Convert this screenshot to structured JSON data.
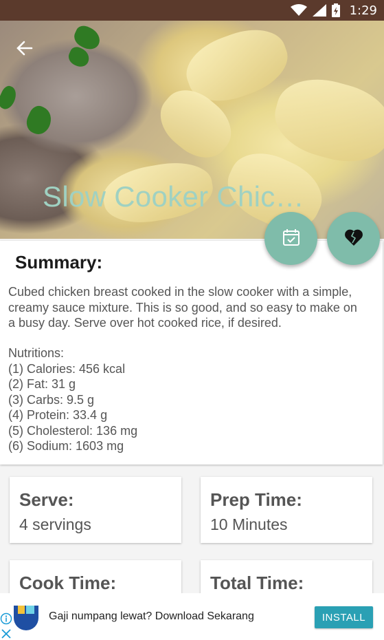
{
  "status_bar": {
    "time": "1:29"
  },
  "hero": {
    "title": "Slow Cooker Chic…"
  },
  "summary": {
    "title": "Summary:",
    "description_lines": [
      "Cubed chicken breast cooked in the slow cooker with a simple,",
      "creamy sauce mixture. This is so good, and so easy to make on",
      "a busy day. Serve over hot cooked rice, if desired."
    ],
    "nutritions_label": "Nutritions:",
    "nutritions": [
      "(1) Calories: 456 kcal",
      "(2) Fat: 31 g",
      "(3) Carbs: 9.5 g",
      "(4) Protein: 33.4 g",
      "(5) Cholesterol: 136 mg",
      "(6) Sodium: 1603 mg"
    ]
  },
  "info": {
    "serve": {
      "label": "Serve:",
      "value": "4 servings"
    },
    "prep": {
      "label": "Prep Time:",
      "value": "10 Minutes"
    },
    "cook": {
      "label": "Cook Time:"
    },
    "total": {
      "label": "Total Time:"
    }
  },
  "ad": {
    "text": "Gaji numpang lewat? Download Sekarang",
    "install_label": "INSTALL"
  },
  "colors": {
    "status_bar": "#5b3a2c",
    "accent": "#7fbcaa",
    "title_text": "#9fd1c2",
    "install_button": "#2aa0b4"
  },
  "icons": [
    "wifi-icon",
    "signal-icon",
    "battery-icon",
    "back-arrow-icon",
    "calendar-check-icon",
    "broken-heart-icon",
    "ad-info-icon",
    "ad-close-icon",
    "app-logo-icon"
  ]
}
